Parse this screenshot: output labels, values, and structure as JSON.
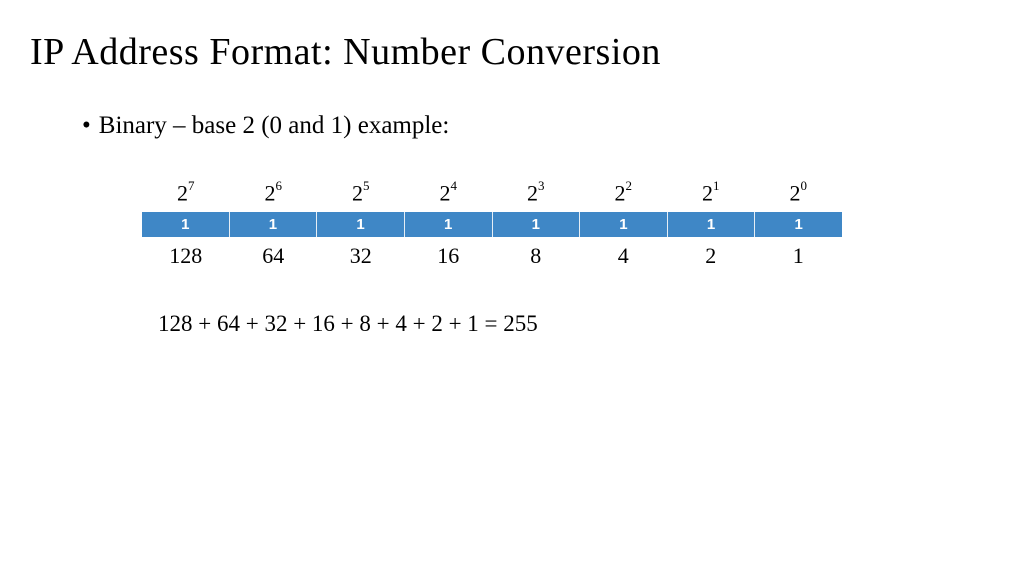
{
  "title": "IP Address Format: Number Conversion",
  "bullet": "Binary – base 2 (0 and 1) example:",
  "powers": {
    "base": "2",
    "exps": [
      "7",
      "6",
      "5",
      "4",
      "3",
      "2",
      "1",
      "0"
    ]
  },
  "bits": [
    "1",
    "1",
    "1",
    "1",
    "1",
    "1",
    "1",
    "1"
  ],
  "values": [
    "128",
    "64",
    "32",
    "16",
    "8",
    "4",
    "2",
    "1"
  ],
  "equation": "128 + 64 + 32 + 16 + 8 + 4 + 2 + 1 = 255"
}
